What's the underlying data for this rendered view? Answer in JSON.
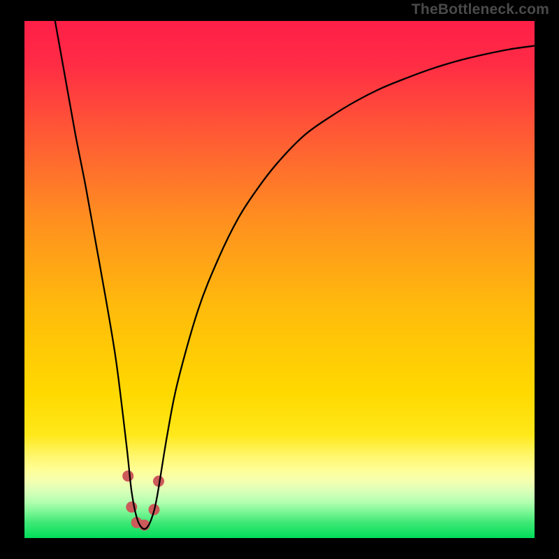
{
  "watermark": "TheBottleneck.com",
  "chart_data": {
    "type": "line",
    "title": "",
    "xlabel": "",
    "ylabel": "",
    "xlim": [
      0,
      100
    ],
    "ylim": [
      0,
      100
    ],
    "background_gradient": {
      "top_color": "#ff1f48",
      "mid_color": "#ffd000",
      "low_color": "#ffff7a",
      "bottom_color": "#00e05a"
    },
    "series": [
      {
        "name": "bottleneck-curve",
        "color": "#000000",
        "x": [
          6,
          8,
          10,
          12,
          14,
          16,
          18,
          20,
          21,
          22,
          23,
          24,
          25,
          26,
          28,
          30,
          34,
          38,
          42,
          46,
          50,
          55,
          60,
          65,
          70,
          75,
          80,
          85,
          90,
          95,
          100
        ],
        "y": [
          100,
          89,
          78,
          68,
          57,
          46,
          34,
          18,
          9,
          4,
          2,
          2,
          4,
          8,
          20,
          30,
          44,
          54,
          62,
          68,
          73,
          78,
          81.5,
          84.5,
          87,
          89,
          90.8,
          92.3,
          93.5,
          94.5,
          95.2
        ]
      }
    ],
    "markers": [
      {
        "name": "dot",
        "x": 20.3,
        "y": 12,
        "r": 8,
        "color": "#cc5a5a"
      },
      {
        "name": "dot",
        "x": 21.0,
        "y": 6,
        "r": 8,
        "color": "#cc5a5a"
      },
      {
        "name": "dot",
        "x": 22.0,
        "y": 3,
        "r": 8,
        "color": "#cc5a5a"
      },
      {
        "name": "dot",
        "x": 23.5,
        "y": 2.5,
        "r": 8,
        "color": "#cc5a5a"
      },
      {
        "name": "dot",
        "x": 25.4,
        "y": 5.5,
        "r": 8,
        "color": "#cc5a5a"
      },
      {
        "name": "dot",
        "x": 26.3,
        "y": 11,
        "r": 8,
        "color": "#cc5a5a"
      }
    ]
  }
}
